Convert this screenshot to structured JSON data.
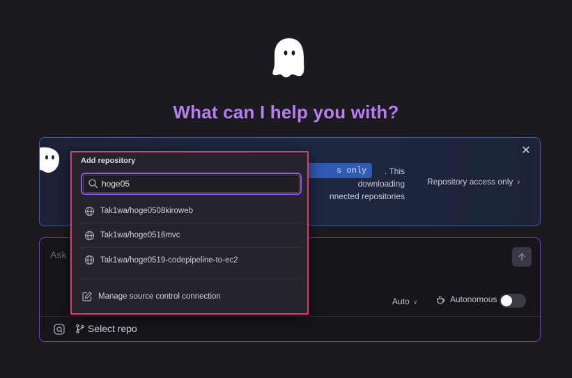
{
  "headline": "What can I help you with?",
  "banner": {
    "code_pill": "s only",
    "text_lines": [
      ". This",
      "downloading",
      "nnected repositories"
    ],
    "repo_access": "Repository access only",
    "repo_access_chevron": "›",
    "close": "✕"
  },
  "chat": {
    "placeholder": "Ask",
    "model": "Auto",
    "autonomous_label": "Autonomous",
    "autonomous_on": false,
    "select_repo": "Select repo"
  },
  "dropdown": {
    "title": "Add repository",
    "search_value": "hoge05",
    "items": [
      {
        "label": "Tak1wa/hoge0508kiroweb",
        "icon": "globe-icon"
      },
      {
        "label": "Tak1wa/hoge0516mvc",
        "icon": "globe-icon"
      },
      {
        "label": "Tak1wa/hoge0519-codepipeline-to-ec2",
        "icon": "globe-icon"
      }
    ],
    "manage_label": "Manage source control connection"
  },
  "colors": {
    "accent_purple": "#b77ef0",
    "banner_border": "#3a5fa8",
    "chat_border": "#6c3fd0",
    "highlight_border": "#e6386e"
  }
}
